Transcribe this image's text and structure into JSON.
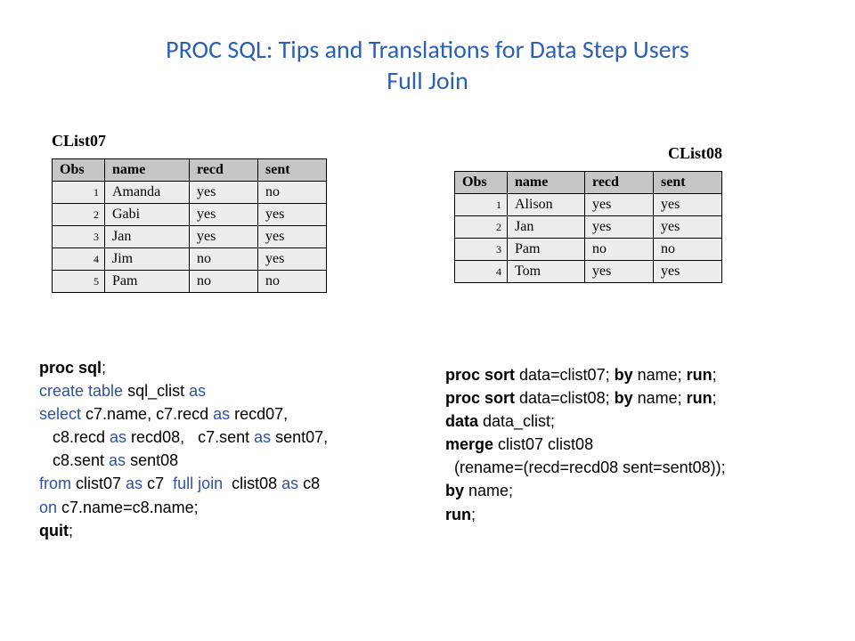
{
  "title_line1": "PROC SQL: Tips and Translations for Data Step Users",
  "title_line2": "Full Join",
  "table_left": {
    "caption": "CList07",
    "headers": {
      "obs": "Obs",
      "name": "name",
      "recd": "recd",
      "sent": "sent"
    },
    "rows": [
      {
        "o": "1",
        "n": "Amanda",
        "r": "yes",
        "s": "no"
      },
      {
        "o": "2",
        "n": "Gabi",
        "r": "yes",
        "s": "yes"
      },
      {
        "o": "3",
        "n": "Jan",
        "r": "yes",
        "s": "yes"
      },
      {
        "o": "4",
        "n": "Jim",
        "r": "no",
        "s": "yes"
      },
      {
        "o": "5",
        "n": "Pam",
        "r": "no",
        "s": "no"
      }
    ]
  },
  "table_right": {
    "caption": "CList08",
    "headers": {
      "obs": "Obs",
      "name": "name",
      "recd": "recd",
      "sent": "sent"
    },
    "rows": [
      {
        "o": "1",
        "n": "Alison",
        "r": "yes",
        "s": "yes"
      },
      {
        "o": "2",
        "n": "Jan",
        "r": "yes",
        "s": "yes"
      },
      {
        "o": "3",
        "n": "Pam",
        "r": "no",
        "s": "no"
      },
      {
        "o": "4",
        "n": "Tom",
        "r": "yes",
        "s": "yes"
      }
    ]
  },
  "sql": {
    "l1a": "proc sql",
    "l1b": ";",
    "l2a": "create table ",
    "l2b": "sql_clist ",
    "l2c": "as",
    "l3a": "select ",
    "l3b": "c7.name, c7.recd ",
    "l3c": "as ",
    "l3d": "recd07,",
    "l4a": "   c8.recd ",
    "l4b": "as ",
    "l4c": "recd08,   c7.sent ",
    "l4d": "as ",
    "l4e": "sent07,",
    "l5a": "   c8.sent ",
    "l5b": "as ",
    "l5c": "sent08",
    "l6a": "from ",
    "l6b": "clist07 ",
    "l6c": "as ",
    "l6d": "c7  ",
    "l6e": "full join  ",
    "l6f": "clist08 ",
    "l6g": "as ",
    "l6h": "c8",
    "l7a": "on ",
    "l7b": "c7.name=c8.name;",
    "l8a": "quit",
    "l8b": ";"
  },
  "ds": {
    "l1a": "proc sort ",
    "l1b": "data=clist07; ",
    "l1c": "by ",
    "l1d": "name; ",
    "l1e": "run",
    "l1f": ";",
    "l2a": "proc sort ",
    "l2b": "data=clist08; ",
    "l2c": "by ",
    "l2d": "name; ",
    "l2e": "run",
    "l2f": ";",
    "l3a": "data ",
    "l3b": "data_clist;",
    "l4a": "merge ",
    "l4b": "clist07 clist08",
    "l5": "  (rename=(recd=recd08 sent=sent08));",
    "l6a": "by ",
    "l6b": "name;",
    "l7a": "run",
    "l7b": ";"
  }
}
